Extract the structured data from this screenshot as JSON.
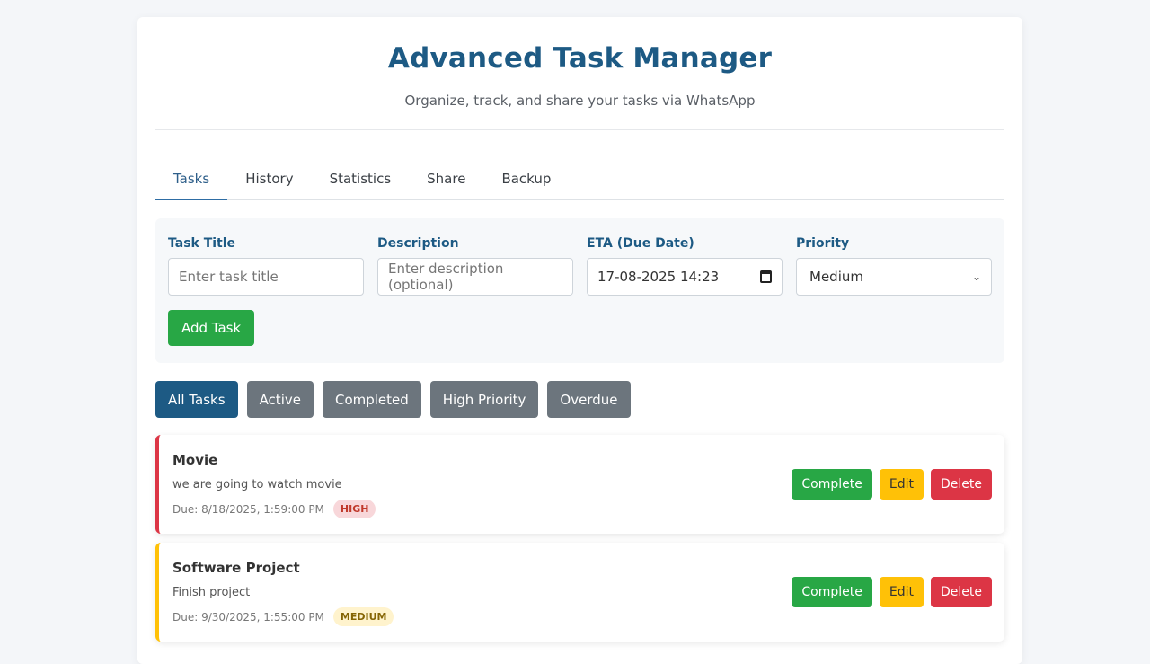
{
  "header": {
    "title": "Advanced Task Manager",
    "subtitle": "Organize, track, and share your tasks via WhatsApp"
  },
  "tabs": [
    {
      "label": "Tasks"
    },
    {
      "label": "History"
    },
    {
      "label": "Statistics"
    },
    {
      "label": "Share"
    },
    {
      "label": "Backup"
    }
  ],
  "form": {
    "title_label": "Task Title",
    "title_placeholder": "Enter task title",
    "desc_label": "Description",
    "desc_placeholder": "Enter description (optional)",
    "eta_label": "ETA (Due Date)",
    "eta_value": "17-08-2025 14:23",
    "priority_label": "Priority",
    "priority_value": "Medium",
    "add_label": "Add Task"
  },
  "filters": [
    {
      "label": "All Tasks"
    },
    {
      "label": "Active"
    },
    {
      "label": "Completed"
    },
    {
      "label": "High Priority"
    },
    {
      "label": "Overdue"
    }
  ],
  "tasks": [
    {
      "title": "Movie",
      "description": "we are going to watch movie",
      "due": "Due: 8/18/2025, 1:59:00 PM",
      "priority": "HIGH",
      "priority_color": "#dc3545",
      "badge_bg": "#f8d7da",
      "badge_fg": "#c0392b"
    },
    {
      "title": "Software Project",
      "description": "Finish project",
      "due": "Due: 9/30/2025, 1:55:00 PM",
      "priority": "MEDIUM",
      "priority_color": "#ffc107",
      "badge_bg": "#fff3cd",
      "badge_fg": "#856404"
    }
  ],
  "actions": {
    "complete": "Complete",
    "edit": "Edit",
    "delete": "Delete"
  },
  "colors": {
    "accent": "#1d5a84",
    "success": "#28a745",
    "warning": "#ffc107",
    "danger": "#dc3545",
    "muted": "#6c757d"
  },
  "icons": {
    "eta_icon": "calendar-icon",
    "priority_icon": "chevron-down-icon"
  }
}
